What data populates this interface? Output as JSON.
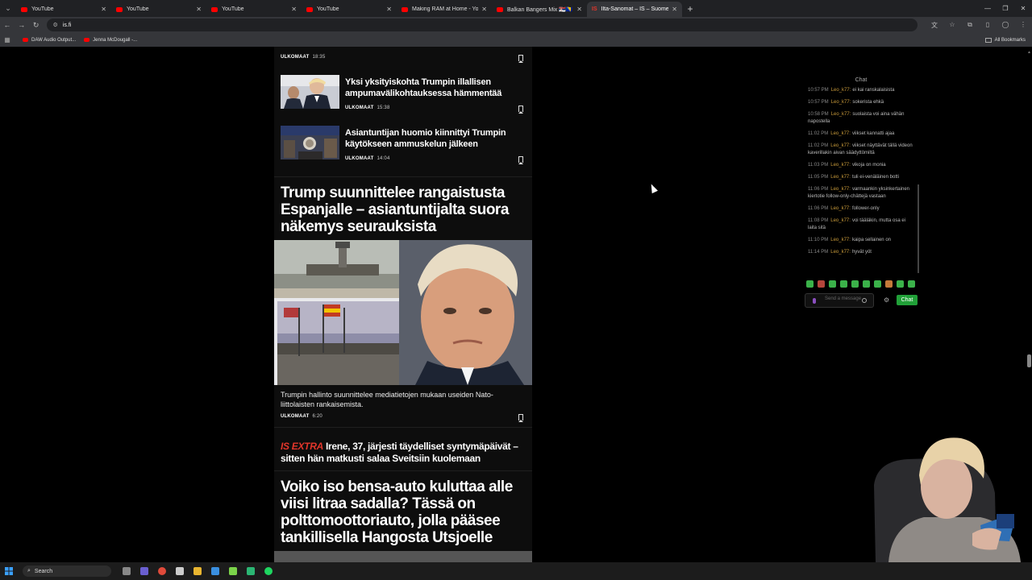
{
  "browser": {
    "tabs": [
      {
        "label": "YouTube",
        "favicon": "youtube-icon"
      },
      {
        "label": "YouTube",
        "favicon": "youtube-icon"
      },
      {
        "label": "YouTube",
        "favicon": "youtube-icon"
      },
      {
        "label": "YouTube",
        "favicon": "youtube-icon"
      },
      {
        "label": "Making RAM at Home - YouTube",
        "favicon": "youtube-icon"
      },
      {
        "label": "Balkan Bangers Mix 🇷🇸🇧🇦🎶 -",
        "favicon": "youtube-icon"
      },
      {
        "label": "Ilta-Sanomat – IS – Suomen suu",
        "favicon": "is-icon",
        "fav_text": "IS",
        "active": true
      }
    ],
    "url": "is.fi",
    "bookmarks": [
      {
        "label": "DAW Audio Output..."
      },
      {
        "label": "Jenna McDougall -..."
      }
    ],
    "all_bookmarks": "All Bookmarks"
  },
  "feed": {
    "top_meta": {
      "category": "ULKOMAAT",
      "time": "18:35"
    },
    "items": [
      {
        "title": "Yksi yksityiskohta Trumpin illallisen ampumavälikohtauksessa hämmentää",
        "category": "ULKOMAAT",
        "time": "15:38"
      },
      {
        "title": "Asiantuntijan huomio kiinnittyi Trumpin käytökseen ammuskelun jälkeen",
        "category": "ULKOMAAT",
        "time": "14:04"
      }
    ],
    "headline": {
      "title": "Trump suunnittelee rangaistusta Espanjalle – asiantuntijalta suora näkemys seurauksista",
      "caption": "Trumpin hallinto suunnittelee mediatietojen mukaan useiden Nato-liittolaisten rankaisemista.",
      "category": "ULKOMAAT",
      "time": "6:20"
    },
    "extra": {
      "tag": "IS EXTRA",
      "title": "Irene, 37, järjesti täydelliset syntymäpäivät – sitten hän matkusti salaa Sveitsiin kuolemaan"
    },
    "headline2": {
      "title": "Voiko iso bensa-auto kuluttaa alle viisi litraa sadalla? Tässä on polttomoottoriauto, jolla pääsee tankillisella Hangosta Utsjoelle"
    }
  },
  "chat": {
    "title": "Chat",
    "messages": [
      {
        "time": "10:57 PM",
        "user": "Leo_k77:",
        "text": "ei kai ranskalaisista"
      },
      {
        "time": "10:57 PM",
        "user": "Leo_k77:",
        "text": "sokerista ehkä"
      },
      {
        "time": "10:58 PM",
        "user": "Leo_k77:",
        "text": "suolaista voi aina vähän napostella"
      },
      {
        "time": "11:02 PM",
        "user": "Leo_k77:",
        "text": "viikset kannatti ajaa"
      },
      {
        "time": "11:02 PM",
        "user": "Leo_k77:",
        "text": "viikset näyttävät tällä videon kaverillakin aivan säädyttömiltä"
      },
      {
        "time": "11:03 PM",
        "user": "Leo_k77:",
        "text": "vikoja on monia"
      },
      {
        "time": "11:05 PM",
        "user": "Leo_k77:",
        "text": "tuli ei-venäläinen botti"
      },
      {
        "time": "11:06 PM",
        "user": "Leo_k77:",
        "text": "varmaankin yksinkertainen kiertotie follow-only-chättejä vastaan"
      },
      {
        "time": "11:06 PM",
        "user": "Leo_k77:",
        "text": "follower-only"
      },
      {
        "time": "11:08 PM",
        "user": "Leo_k77:",
        "text": "voi tääläkin, mutta osa ei laita sitä"
      },
      {
        "time": "11:10 PM",
        "user": "Leo_k77:",
        "text": "kaipa sellainen on"
      },
      {
        "time": "11:14 PM",
        "user": "Leo_k77:",
        "text": "hyvät yöt"
      }
    ],
    "input_placeholder": "Send a message",
    "send_label": "Chat"
  },
  "taskbar": {
    "search_label": "Search"
  },
  "colors": {
    "brand_red": "#e3362b",
    "chat_username": "#c89a3a",
    "chat_button": "#21a038"
  }
}
